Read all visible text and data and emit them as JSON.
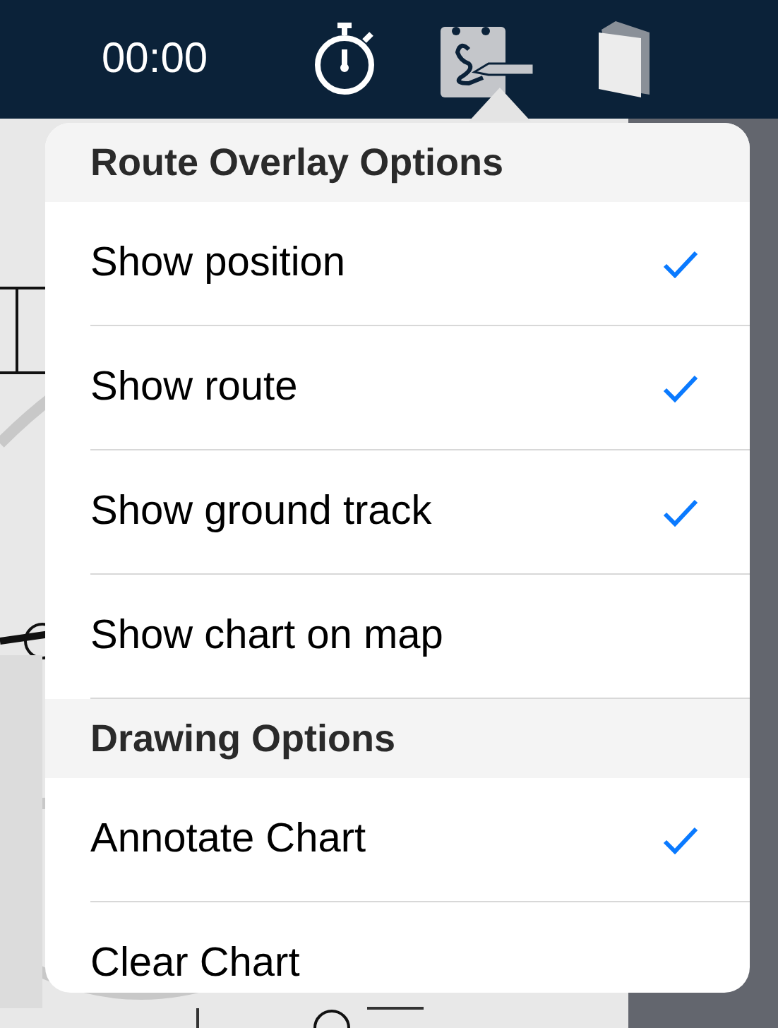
{
  "toolbar": {
    "timer": "00:00",
    "tools": [
      {
        "kind": "stopwatch"
      },
      {
        "kind": "annotate"
      },
      {
        "kind": "book"
      }
    ]
  },
  "popover": {
    "sections": [
      {
        "title": "Route Overlay Options",
        "items": [
          {
            "label": "Show position",
            "checked": true
          },
          {
            "label": "Show route",
            "checked": true
          },
          {
            "label": "Show ground track",
            "checked": true
          },
          {
            "label": "Show chart on map",
            "checked": false
          }
        ]
      },
      {
        "title": "Drawing Options",
        "items": [
          {
            "label": "Annotate Chart",
            "checked": true
          },
          {
            "label": "Clear Chart",
            "checked": false
          }
        ]
      }
    ]
  }
}
